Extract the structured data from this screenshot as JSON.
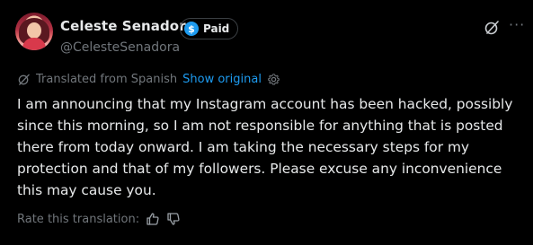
{
  "author": {
    "display_name": "Celeste Senadora",
    "handle": "@CelesteSenadora",
    "badge_label": "Paid",
    "badge_icon": "dollar-icon"
  },
  "translation": {
    "notice": "Translated from Spanish",
    "show_original": "Show original"
  },
  "tweet": {
    "text": "I am announcing that my Instagram account has been hacked, possibly since this morning, so I am not responsible for anything that is posted there from today onward. I am taking the necessary steps for my protection and that of my followers. Please excuse any inconvenience this may cause you."
  },
  "rating": {
    "label": "Rate this translation:"
  },
  "colors": {
    "background": "#000000",
    "text": "#e7e9ea",
    "muted": "#71767b",
    "accent": "#1d9bf0"
  }
}
